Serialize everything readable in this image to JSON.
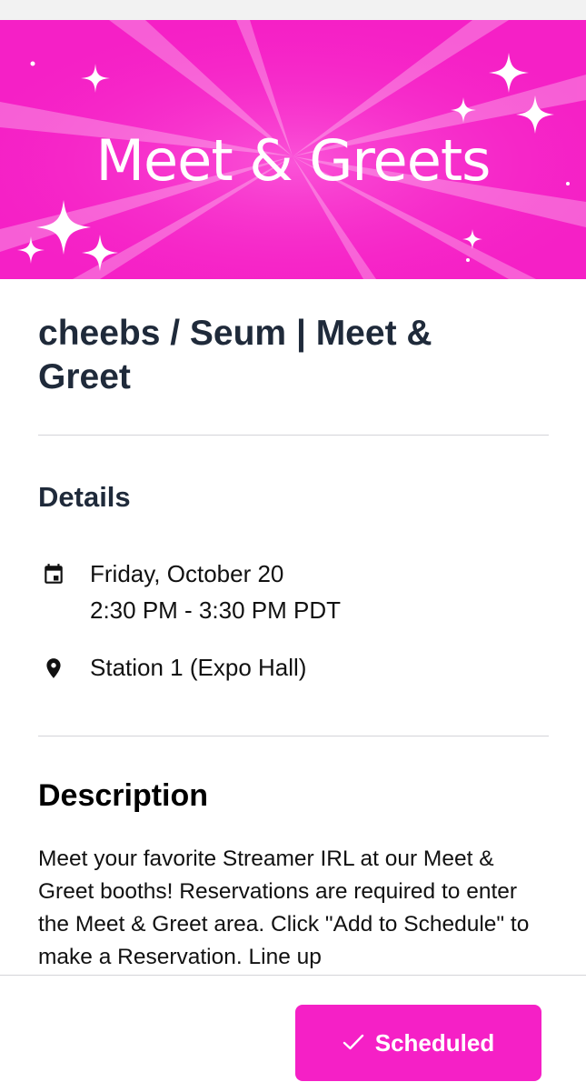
{
  "banner": {
    "title": "Meet & Greets"
  },
  "event": {
    "title": "cheebs / Seum | Meet & Greet"
  },
  "details": {
    "heading": "Details",
    "date": "Friday, October 20",
    "time": "2:30 PM - 3:30 PM PDT",
    "location": "Station 1 (Expo Hall)",
    "date_icon": "calendar-icon",
    "location_icon": "location-pin-icon"
  },
  "description": {
    "heading": "Description",
    "text": "Meet your favorite Streamer IRL at our Meet & Greet booths! Reservations are required to enter the Meet & Greet area. Click \"Add to Schedule\" to make a Reservation. Line up"
  },
  "action": {
    "label": "Scheduled",
    "icon": "checkmark-icon"
  },
  "colors": {
    "accent": "#f520c6",
    "title": "#1f2a3a",
    "divider": "#d4d4d8"
  }
}
